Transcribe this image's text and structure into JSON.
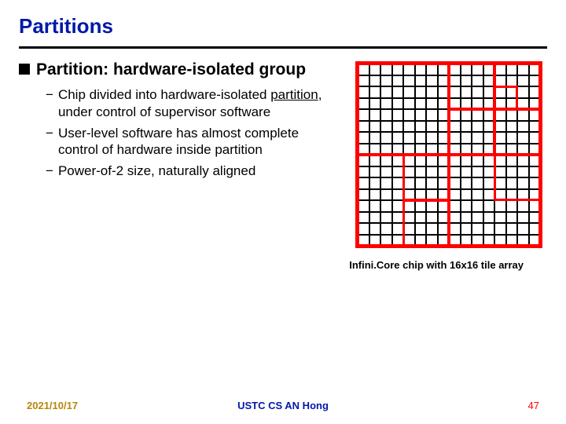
{
  "title": "Partitions",
  "heading": "Partition: hardware-isolated group",
  "bullets": [
    {
      "pre": "Chip divided into hardware-isolated ",
      "u": "partition",
      "post": ", under control of supervisor software"
    },
    {
      "pre": "User-level software has almost complete control of hardware inside partition",
      "u": "",
      "post": ""
    },
    {
      "pre": "Power-of-2 size, naturally aligned",
      "u": "",
      "post": ""
    }
  ],
  "figure": {
    "grid": 16,
    "caption": "Infini.Core chip with 16x16 tile array",
    "partitions": [
      {
        "col": 0,
        "row": 0,
        "w": 8,
        "h": 8
      },
      {
        "col": 8,
        "row": 0,
        "w": 4,
        "h": 4
      },
      {
        "col": 12,
        "row": 0,
        "w": 4,
        "h": 4
      },
      {
        "col": 12,
        "row": 2,
        "w": 2,
        "h": 2
      },
      {
        "col": 8,
        "row": 4,
        "w": 4,
        "h": 4
      },
      {
        "col": 12,
        "row": 4,
        "w": 4,
        "h": 4
      },
      {
        "col": 0,
        "row": 8,
        "w": 8,
        "h": 8
      },
      {
        "col": 4,
        "row": 8,
        "w": 4,
        "h": 4
      },
      {
        "col": 4,
        "row": 12,
        "w": 4,
        "h": 4
      },
      {
        "col": 8,
        "row": 8,
        "w": 8,
        "h": 8
      },
      {
        "col": 12,
        "row": 8,
        "w": 4,
        "h": 4
      }
    ]
  },
  "footer": {
    "date": "2021/10/17",
    "center": "USTC CS AN Hong",
    "page": "47"
  }
}
